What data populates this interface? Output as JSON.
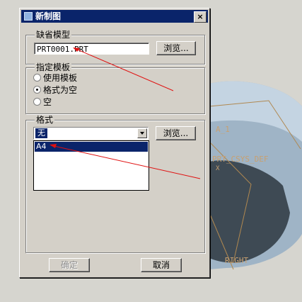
{
  "background_scene": {
    "labels": {
      "datum_a": "A_1",
      "csys": "PRT_CSYS_DEF",
      "csys_axis": "X",
      "datum_right": "RIGHT"
    },
    "colors": {
      "annotation_arrow": "#e01010",
      "datum_color": "#c8a070"
    }
  },
  "dialog": {
    "title": "新制图",
    "close_label": "×",
    "default_model": {
      "legend": "缺省模型",
      "value": "PRT0001.PRT",
      "browse_label": "浏览..."
    },
    "template": {
      "legend": "指定模板",
      "options": [
        {
          "label": "使用模板",
          "checked": false
        },
        {
          "label": "格式为空",
          "checked": true
        },
        {
          "label": "空",
          "checked": false
        }
      ]
    },
    "format": {
      "legend": "格式",
      "selected": "无",
      "browse_label": "浏览...",
      "list_items": [
        "A4"
      ]
    },
    "ok_label": "确定",
    "cancel_label": "取消"
  }
}
